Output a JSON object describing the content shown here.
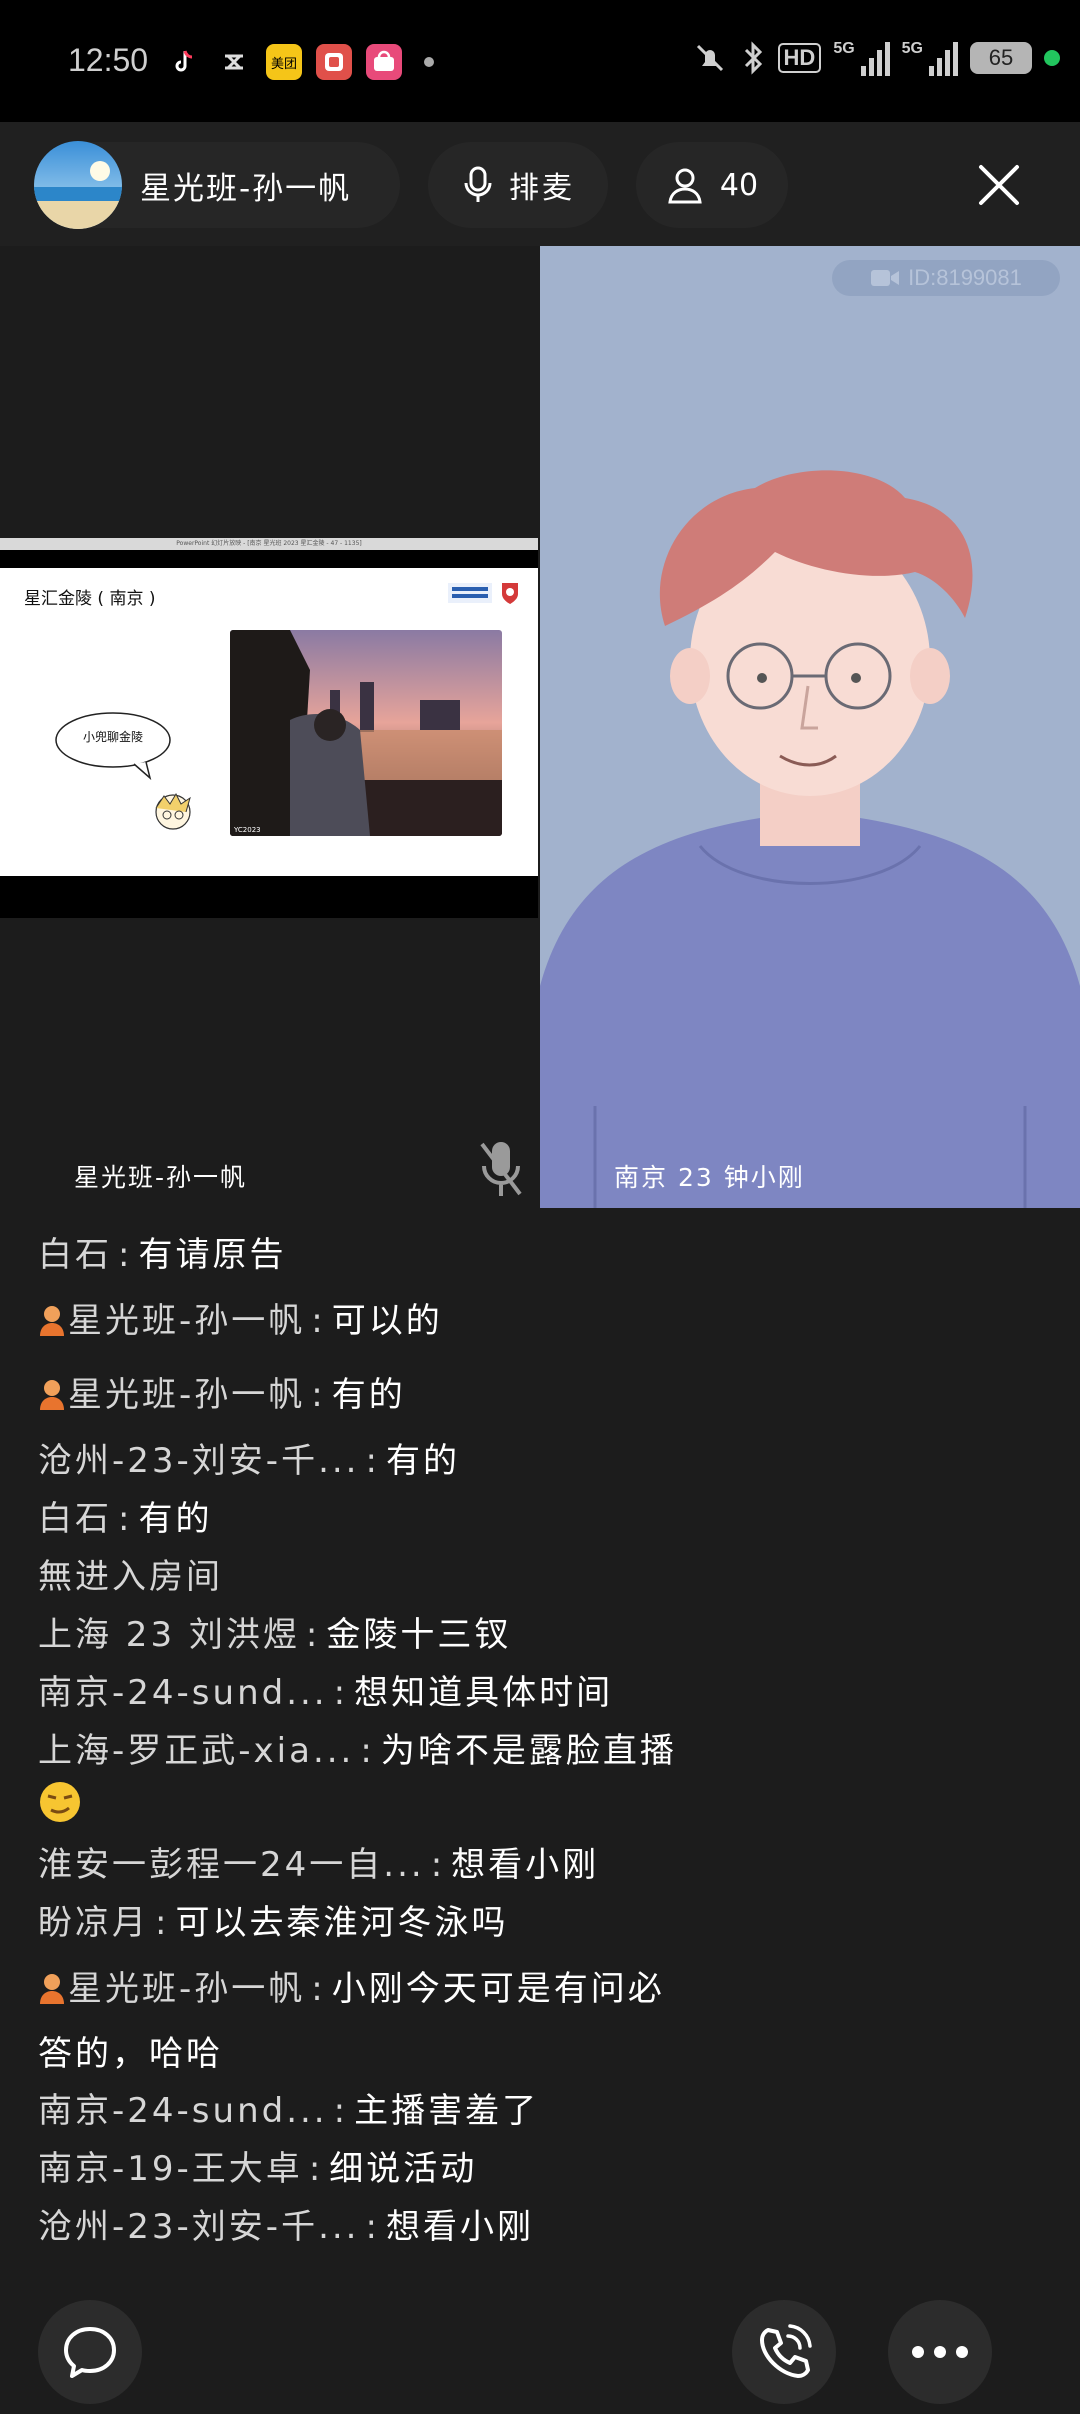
{
  "status_bar": {
    "time": "12:50",
    "apps": [
      {
        "icon": "tiktok-icon",
        "color": "#111111"
      },
      {
        "icon": "app-x-icon",
        "color": "#111111"
      },
      {
        "icon": "meituan-icon",
        "label": "美团",
        "color": "#f5c518"
      },
      {
        "icon": "pinduoduo-icon",
        "color": "#e0504a"
      },
      {
        "icon": "shopping-icon",
        "color": "#e84a7a"
      }
    ],
    "hd_label": "HD",
    "hd_sub": "1 2",
    "network_1": "5G",
    "network_2": "5G",
    "battery": "65"
  },
  "header": {
    "host_name": "星光班-孙一帆",
    "queue_label": "排麦",
    "viewer_count": "40"
  },
  "stage": {
    "slide_window_title": "PowerPoint 幻灯片放映 - [南京 星光班 2023 星汇金陵 - 47 - 1135]",
    "slide_title": "星汇金陵 ( 南京 )",
    "slide_bubble": "小兜聊金陵",
    "slide_photo_caption": "YC2023",
    "host_label": "星光班-孙一帆",
    "guest_id": "ID:8199081",
    "guest_label": "南京 23 钟小刚"
  },
  "chat": [
    {
      "user": "白石",
      "text": "有请原告",
      "host": false
    },
    {
      "user": "星光班-孙一帆",
      "text": "可以的",
      "host": true
    },
    {
      "user": "星光班-孙一帆",
      "text": "有的",
      "host": true
    },
    {
      "user": "沧州-23-刘安-千...",
      "text": "有的",
      "host": false
    },
    {
      "user": "白石",
      "text": "有的",
      "host": false
    },
    {
      "user": "",
      "text": "無进入房间",
      "host": false,
      "system": true
    },
    {
      "user": "上海 23 刘洪煜",
      "text": "金陵十三钗",
      "host": false
    },
    {
      "user": "南京-24-sund...",
      "text": "想知道具体时间",
      "host": false
    },
    {
      "user": "上海-罗正武-xia...",
      "text": "为啥不是露脸直播",
      "host": false,
      "emoji": "😏"
    },
    {
      "user": "淮安一彭程一24一自...",
      "text": "想看小刚",
      "host": false
    },
    {
      "user": "盼凉月",
      "text": "可以去秦淮河冬泳吗",
      "host": false
    },
    {
      "user": "星光班-孙一帆",
      "text": "小刚今天可是有问必",
      "host": true,
      "cont": "答的，哈哈"
    },
    {
      "user": "南京-24-sund...",
      "text": "主播害羞了",
      "host": false
    },
    {
      "user": "南京-19-王大卓",
      "text": "细说活动",
      "host": false
    },
    {
      "user": "沧州-23-刘安-千...",
      "text": "想看小刚",
      "host": false
    }
  ],
  "colors": {
    "background": "#1c1c1c",
    "pill": "#262626",
    "guest_bg": "#a2b2cd",
    "sweater": "#7e86c2"
  }
}
